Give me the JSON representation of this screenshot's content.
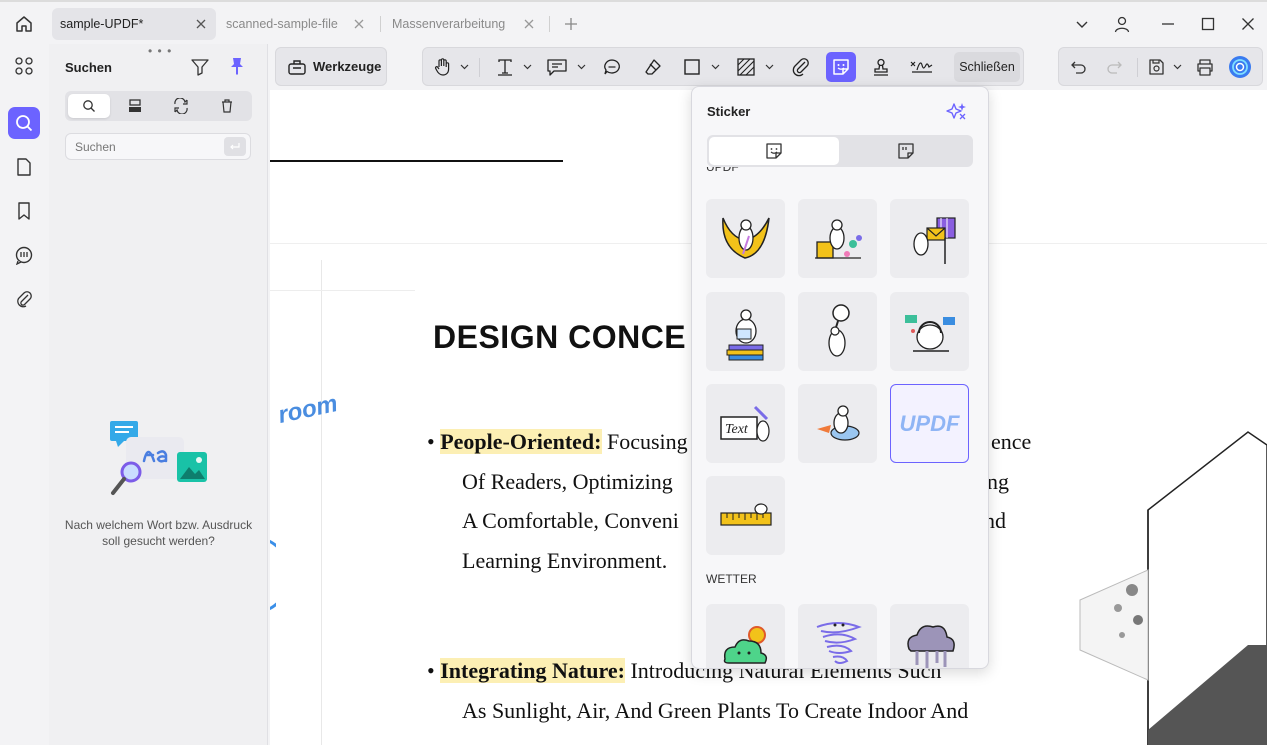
{
  "tabs": [
    {
      "label": "sample-UPDF*",
      "active": true
    },
    {
      "label": "scanned-sample-file",
      "active": false
    },
    {
      "label": "Massenverarbeitung",
      "active": false
    }
  ],
  "panel": {
    "title": "Suchen",
    "search_placeholder": "Suchen",
    "empty_message": "Nach welchem Wort bzw. Ausdruck soll gesucht werden?"
  },
  "toolbar": {
    "tools_label": "Werkzeuge",
    "close_label": "Schließen"
  },
  "document": {
    "heading": "DESIGN CONCE",
    "room_text": "room",
    "bullet1": {
      "term": "People-Oriented:",
      "line1_rest": " Focusing",
      "line1_right": "ence",
      "line2": "Of Readers, Optimizing",
      "line2_right": "ng",
      "line3": "A Comfortable, Conveni",
      "line3_right": "nd",
      "line4": "Learning Environment."
    },
    "bullet2": {
      "term": "Integrating Nature:",
      "line1_rest": " Introducing Natural Elements Such",
      "line2": "As Sunlight, Air, And Green Plants To Create Indoor And"
    }
  },
  "sticker_popup": {
    "title": "Sticker",
    "section_top": "UPDF",
    "section_weather": "WETTER",
    "selected_label": "UPDF"
  },
  "colors": {
    "accent": "#6c63ff",
    "highlight": "#fcefb4"
  }
}
